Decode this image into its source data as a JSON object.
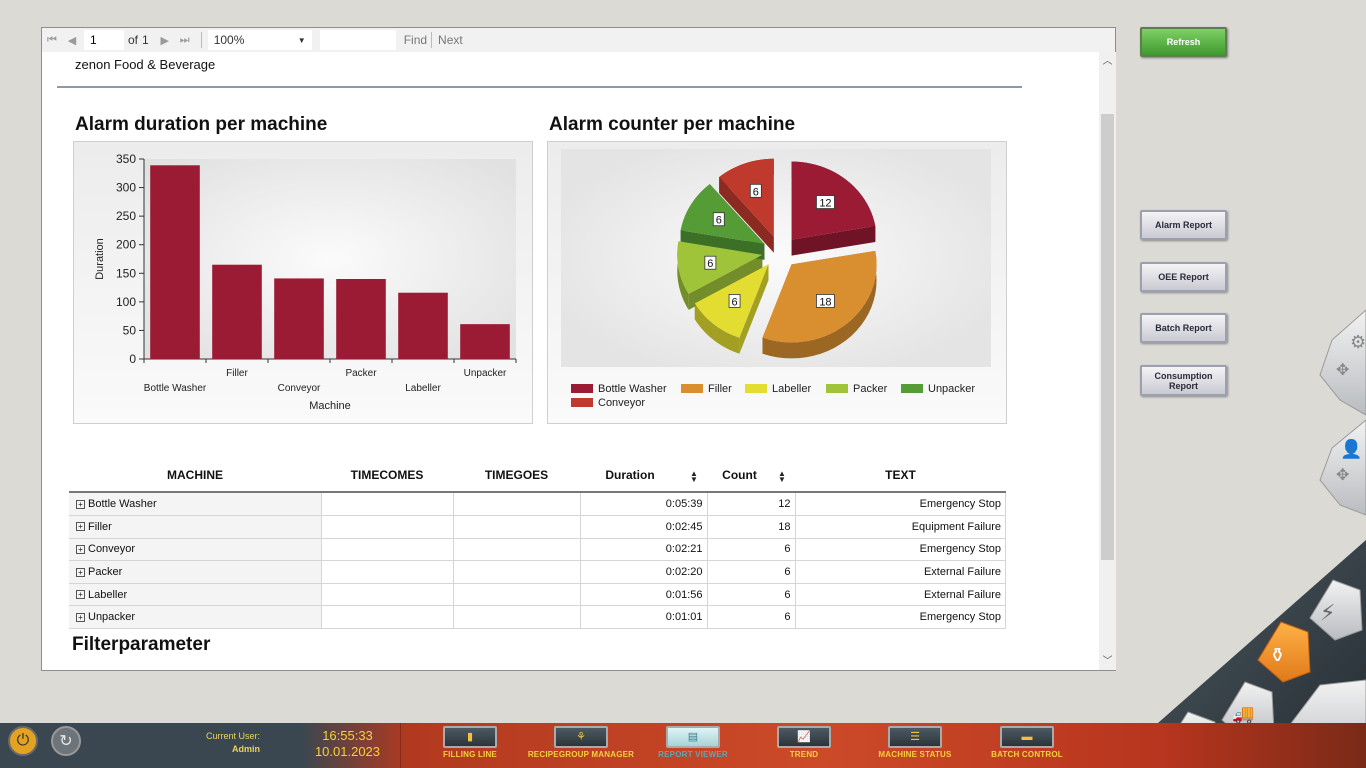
{
  "toolbar": {
    "page_value": "1",
    "of_label": "of",
    "total_pages": "1",
    "zoom_value": "100%",
    "find_label": "Find",
    "next_label": "Next"
  },
  "report": {
    "company": "zenon Food & Beverage",
    "bar_title": "Alarm duration per machine",
    "pie_title": "Alarm counter per machine",
    "filter_title": "Filterparameter"
  },
  "chart_data": [
    {
      "type": "bar",
      "title": "Alarm duration per machine",
      "categories": [
        "Bottle Washer",
        "Filler",
        "Conveyor",
        "Packer",
        "Labeller",
        "Unpacker"
      ],
      "values": [
        339,
        165,
        141,
        140,
        116,
        61
      ],
      "xlabel": "Machine",
      "ylabel": "Duration",
      "ylim": [
        0,
        350
      ],
      "yticks": [
        0,
        50,
        100,
        150,
        200,
        250,
        300,
        350
      ],
      "color": "#9b1b35",
      "grid": false
    },
    {
      "type": "pie",
      "title": "Alarm counter per machine",
      "categories": [
        "Bottle Washer",
        "Filler",
        "Labeller",
        "Packer",
        "Unpacker",
        "Conveyor"
      ],
      "values": [
        12,
        18,
        6,
        6,
        6,
        6
      ],
      "colors": [
        "#9b1b35",
        "#d98f2f",
        "#e3dd31",
        "#9fc43a",
        "#559b36",
        "#bf3a2c"
      ],
      "legend_position": "bottom"
    }
  ],
  "table": {
    "headers": [
      "MACHINE",
      "TIMECOMES",
      "TIMEGOES",
      "Duration",
      "Count",
      "TEXT"
    ],
    "rows": [
      {
        "machine": "Bottle Washer",
        "duration": "0:05:39",
        "count": "12",
        "text": "Emergency Stop"
      },
      {
        "machine": "Filler",
        "duration": "0:02:45",
        "count": "18",
        "text": "Equipment Failure"
      },
      {
        "machine": "Conveyor",
        "duration": "0:02:21",
        "count": "6",
        "text": "Emergency Stop"
      },
      {
        "machine": "Packer",
        "duration": "0:02:20",
        "count": "6",
        "text": "External Failure"
      },
      {
        "machine": "Labeller",
        "duration": "0:01:56",
        "count": "6",
        "text": "External Failure"
      },
      {
        "machine": "Unpacker",
        "duration": "0:01:01",
        "count": "6",
        "text": "Emergency Stop"
      }
    ]
  },
  "side_buttons": {
    "refresh": "Refresh",
    "alarm_report": "Alarm Report",
    "oee_report": "OEE Report",
    "batch_report": "Batch Report",
    "consumption_report": "Consumption Report"
  },
  "status": {
    "user_label": "Current User:",
    "user_name": "Admin",
    "time": "16:55:33",
    "date": "10.01.2023"
  },
  "nav": [
    {
      "label": "FILLING LINE",
      "icon": "bottle-icon"
    },
    {
      "label": "RECIPEGROUP MANAGER",
      "icon": "recipe-icon"
    },
    {
      "label": "REPORT VIEWER",
      "icon": "report-icon",
      "active": true
    },
    {
      "label": "TREND",
      "icon": "trend-icon"
    },
    {
      "label": "MACHINE STATUS",
      "icon": "status-list-icon"
    },
    {
      "label": "BATCH CONTROL",
      "icon": "batch-icon"
    }
  ],
  "colors": {
    "accent": "#f5d23c",
    "bar": "#9b1b35",
    "bottom_bar_left": "#3a4750",
    "bottom_bar_right": "#cc4a28"
  }
}
